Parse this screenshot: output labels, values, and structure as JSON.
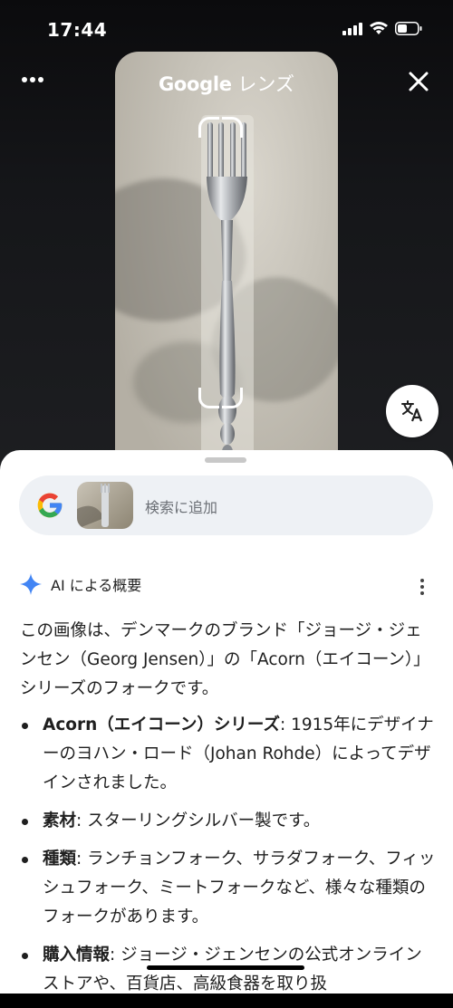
{
  "status_bar": {
    "time": "17:44"
  },
  "header": {
    "title_brand": "Google",
    "title_product": "レンズ"
  },
  "search": {
    "placeholder": "検索に追加"
  },
  "ai_overview": {
    "label": "AI による概要",
    "intro": "この画像は、デンマークのブランド「ジョージ・ジェンセン（Georg Jensen）」の「Acorn（エイコーン）」シリーズのフォークです。",
    "bullets": [
      {
        "title": "Acorn（エイコーン）シリーズ",
        "text": ": 1915年にデザイナーのヨハン・ロード（Johan Rohde）によってデザインされました。"
      },
      {
        "title": "素材",
        "text": ": スターリングシルバー製です。"
      },
      {
        "title": "種類",
        "text": ": ランチョンフォーク、サラダフォーク、フィッシュフォーク、ミートフォークなど、様々な種類のフォークがあります。"
      },
      {
        "title": "購入情報",
        "text": ": ジョージ・ジェンセンの公式オンラインストアや、百貨店、高級食器を取り扱"
      }
    ]
  },
  "icons": {
    "menu": "more-horizontal-icon",
    "close": "close-icon",
    "translate": "translate-icon",
    "google": "google-g-icon",
    "ai": "sparkle-icon",
    "more": "more-vertical-icon"
  },
  "colors": {
    "google_blue": "#4285F4",
    "google_red": "#EA4335",
    "google_yellow": "#FBBC05",
    "google_green": "#34A853",
    "sheet_bg": "#ffffff",
    "pill_bg": "#eef1f5"
  }
}
